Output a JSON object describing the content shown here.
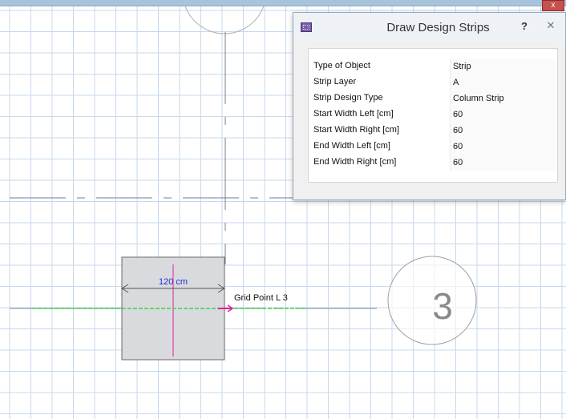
{
  "window": {
    "close_glyph": "x"
  },
  "canvas": {
    "dimension_text": "120 cm",
    "grid_point_text": "Grid Point  L  3",
    "bubble_label": "3",
    "colors": {
      "grid": "#c5d9ee",
      "axis": "#8a9bb0",
      "column_fill": "#d9dadd",
      "dimension_text": "#1f2fd6",
      "strip": "#45d045",
      "snap_marker": "#e0209a"
    }
  },
  "dialog": {
    "title": "Draw Design Strips",
    "help_label": "?",
    "close_label": "✕",
    "icon": "strip-grid-icon",
    "properties": [
      {
        "key": "Type of Object",
        "value": "Strip"
      },
      {
        "key": "Strip Layer",
        "value": "A"
      },
      {
        "key": "Strip Design Type",
        "value": "Column Strip"
      },
      {
        "key": "Start Width Left  [cm]",
        "value": "60"
      },
      {
        "key": "Start Width Right  [cm]",
        "value": "60"
      },
      {
        "key": "End Width Left  [cm]",
        "value": "60"
      },
      {
        "key": "End Width Right  [cm]",
        "value": "60"
      }
    ]
  }
}
